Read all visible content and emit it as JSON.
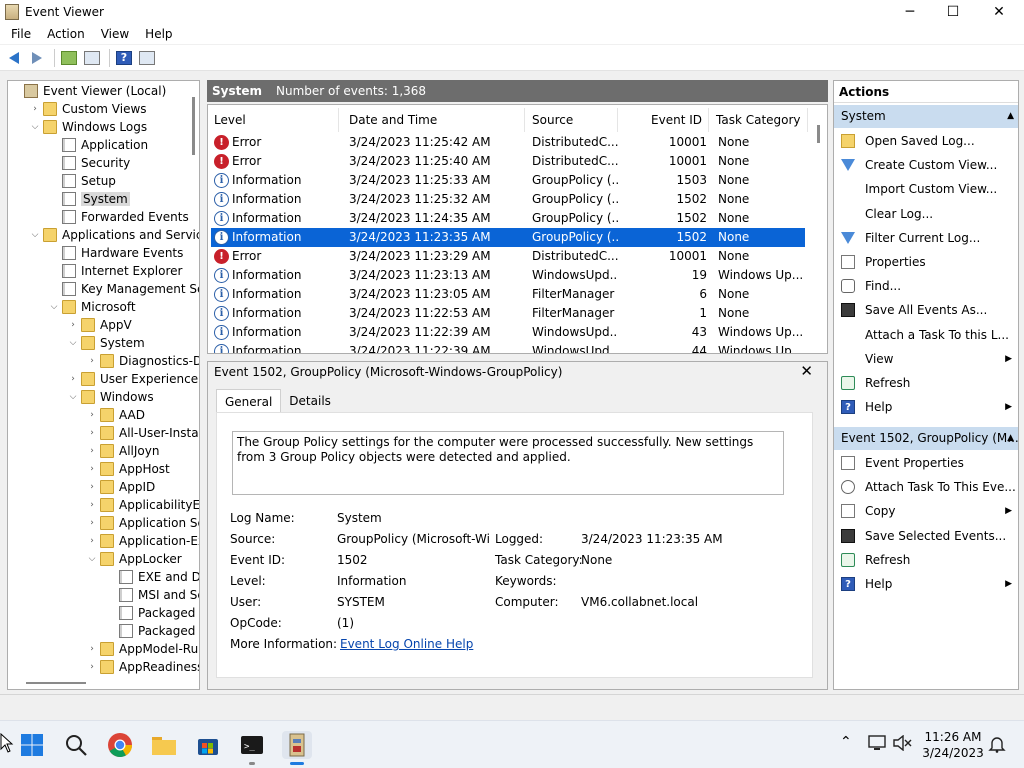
{
  "window": {
    "title": "Event Viewer",
    "minimize": "─",
    "maximize": "☐",
    "close": "✕"
  },
  "menu": [
    "File",
    "Action",
    "View",
    "Help"
  ],
  "tree": [
    {
      "label": "Event Viewer (Local)",
      "indent": 0,
      "chev": "",
      "icon": "root"
    },
    {
      "label": "Custom Views",
      "indent": 1,
      "chev": "›",
      "icon": "folder"
    },
    {
      "label": "Windows Logs",
      "indent": 1,
      "chev": "⌄",
      "icon": "folder"
    },
    {
      "label": "Application",
      "indent": 2,
      "chev": "",
      "icon": "log"
    },
    {
      "label": "Security",
      "indent": 2,
      "chev": "",
      "icon": "log"
    },
    {
      "label": "Setup",
      "indent": 2,
      "chev": "",
      "icon": "log"
    },
    {
      "label": "System",
      "indent": 2,
      "chev": "",
      "icon": "log",
      "selected": true
    },
    {
      "label": "Forwarded Events",
      "indent": 2,
      "chev": "",
      "icon": "log"
    },
    {
      "label": "Applications and Services",
      "indent": 1,
      "chev": "⌄",
      "icon": "folder"
    },
    {
      "label": "Hardware Events",
      "indent": 2,
      "chev": "",
      "icon": "log"
    },
    {
      "label": "Internet Explorer",
      "indent": 2,
      "chev": "",
      "icon": "log"
    },
    {
      "label": "Key Management Ser",
      "indent": 2,
      "chev": "",
      "icon": "log"
    },
    {
      "label": "Microsoft",
      "indent": 2,
      "chev": "⌄",
      "icon": "folder"
    },
    {
      "label": "AppV",
      "indent": 3,
      "chev": "›",
      "icon": "folder"
    },
    {
      "label": "System",
      "indent": 3,
      "chev": "⌄",
      "icon": "folder"
    },
    {
      "label": "Diagnostics-Di",
      "indent": 4,
      "chev": "›",
      "icon": "folder"
    },
    {
      "label": "User Experience Vi",
      "indent": 3,
      "chev": "›",
      "icon": "folder"
    },
    {
      "label": "Windows",
      "indent": 3,
      "chev": "⌄",
      "icon": "folder"
    },
    {
      "label": "AAD",
      "indent": 4,
      "chev": "›",
      "icon": "folder"
    },
    {
      "label": "All-User-Instal",
      "indent": 4,
      "chev": "›",
      "icon": "folder"
    },
    {
      "label": "AllJoyn",
      "indent": 4,
      "chev": "›",
      "icon": "folder"
    },
    {
      "label": "AppHost",
      "indent": 4,
      "chev": "›",
      "icon": "folder"
    },
    {
      "label": "AppID",
      "indent": 4,
      "chev": "›",
      "icon": "folder"
    },
    {
      "label": "ApplicabilityEr",
      "indent": 4,
      "chev": "›",
      "icon": "folder"
    },
    {
      "label": "Application Se",
      "indent": 4,
      "chev": "›",
      "icon": "folder"
    },
    {
      "label": "Application-Ex",
      "indent": 4,
      "chev": "›",
      "icon": "folder"
    },
    {
      "label": "AppLocker",
      "indent": 4,
      "chev": "⌄",
      "icon": "folder"
    },
    {
      "label": "EXE and DL",
      "indent": 5,
      "chev": "",
      "icon": "log"
    },
    {
      "label": "MSI and Sc",
      "indent": 5,
      "chev": "",
      "icon": "log"
    },
    {
      "label": "Packaged a",
      "indent": 5,
      "chev": "",
      "icon": "log"
    },
    {
      "label": "Packaged a",
      "indent": 5,
      "chev": "",
      "icon": "log"
    },
    {
      "label": "AppModel-Ru",
      "indent": 4,
      "chev": "›",
      "icon": "folder"
    },
    {
      "label": "AppReadiness",
      "indent": 4,
      "chev": "›",
      "icon": "folder"
    }
  ],
  "log_header": {
    "name": "System",
    "count": "Number of events: 1,368"
  },
  "columns": [
    "Level",
    "Date and Time",
    "Source",
    "Event ID",
    "Task Category"
  ],
  "events": [
    {
      "level": "Error",
      "kind": "err",
      "date": "3/24/2023 11:25:42 AM",
      "source": "DistributedC...",
      "id": "10001",
      "task": "None"
    },
    {
      "level": "Error",
      "kind": "err",
      "date": "3/24/2023 11:25:40 AM",
      "source": "DistributedC...",
      "id": "10001",
      "task": "None"
    },
    {
      "level": "Information",
      "kind": "inf",
      "date": "3/24/2023 11:25:33 AM",
      "source": "GroupPolicy (...",
      "id": "1503",
      "task": "None"
    },
    {
      "level": "Information",
      "kind": "inf",
      "date": "3/24/2023 11:25:32 AM",
      "source": "GroupPolicy (...",
      "id": "1502",
      "task": "None"
    },
    {
      "level": "Information",
      "kind": "inf",
      "date": "3/24/2023 11:24:35 AM",
      "source": "GroupPolicy (...",
      "id": "1502",
      "task": "None"
    },
    {
      "level": "Information",
      "kind": "inf",
      "date": "3/24/2023 11:23:35 AM",
      "source": "GroupPolicy (...",
      "id": "1502",
      "task": "None",
      "selected": true
    },
    {
      "level": "Error",
      "kind": "err",
      "date": "3/24/2023 11:23:29 AM",
      "source": "DistributedC...",
      "id": "10001",
      "task": "None"
    },
    {
      "level": "Information",
      "kind": "inf",
      "date": "3/24/2023 11:23:13 AM",
      "source": "WindowsUpd...",
      "id": "19",
      "task": "Windows Up..."
    },
    {
      "level": "Information",
      "kind": "inf",
      "date": "3/24/2023 11:23:05 AM",
      "source": "FilterManager",
      "id": "6",
      "task": "None"
    },
    {
      "level": "Information",
      "kind": "inf",
      "date": "3/24/2023 11:22:53 AM",
      "source": "FilterManager",
      "id": "1",
      "task": "None"
    },
    {
      "level": "Information",
      "kind": "inf",
      "date": "3/24/2023 11:22:39 AM",
      "source": "WindowsUpd...",
      "id": "43",
      "task": "Windows Up..."
    },
    {
      "level": "Information",
      "kind": "inf",
      "date": "3/24/2023 11:22:39 AM",
      "source": "WindowsUpd...",
      "id": "44",
      "task": "Windows Up..."
    }
  ],
  "detail": {
    "title": "Event 1502, GroupPolicy (Microsoft-Windows-GroupPolicy)",
    "close": "✕",
    "tab_general": "General",
    "tab_details": "Details",
    "description": "The Group Policy settings for the computer were processed successfully. New settings from 3 Group Policy objects were detected and applied.",
    "log_name_label": "Log Name:",
    "log_name": "System",
    "source_label": "Source:",
    "source": "GroupPolicy (Microsoft-Win",
    "logged_label": "Logged:",
    "logged": "3/24/2023 11:23:35 AM",
    "event_id_label": "Event ID:",
    "event_id": "1502",
    "task_label": "Task Category:",
    "task": "None",
    "level_label": "Level:",
    "level": "Information",
    "keywords_label": "Keywords:",
    "keywords": "",
    "user_label": "User:",
    "user": "SYSTEM",
    "computer_label": "Computer:",
    "computer": "VM6.collabnet.local",
    "opcode_label": "OpCode:",
    "opcode": "(1)",
    "more_label": "More Information:",
    "more_link": "Event Log Online Help"
  },
  "actions": {
    "title": "Actions",
    "section1": "System",
    "items1": [
      {
        "label": "Open Saved Log...",
        "icon": "open"
      },
      {
        "label": "Create Custom View...",
        "icon": "filter"
      },
      {
        "label": "Import Custom View...",
        "icon": "blank"
      },
      {
        "label": "Clear Log...",
        "icon": "blank"
      },
      {
        "label": "Filter Current Log...",
        "icon": "filter"
      },
      {
        "label": "Properties",
        "icon": "doc"
      },
      {
        "label": "Find...",
        "icon": "find"
      },
      {
        "label": "Save All Events As...",
        "icon": "save"
      },
      {
        "label": "Attach a Task To this L...",
        "icon": "blank"
      },
      {
        "label": "View",
        "icon": "blank",
        "sub": true
      },
      {
        "label": "Refresh",
        "icon": "refresh"
      },
      {
        "label": "Help",
        "icon": "help",
        "sub": true
      }
    ],
    "section2": "Event 1502, GroupPolicy (M...",
    "items2": [
      {
        "label": "Event Properties",
        "icon": "doc"
      },
      {
        "label": "Attach Task To This Eve...",
        "icon": "clock"
      },
      {
        "label": "Copy",
        "icon": "doc",
        "sub": true
      },
      {
        "label": "Save Selected Events...",
        "icon": "save"
      },
      {
        "label": "Refresh",
        "icon": "refresh"
      },
      {
        "label": "Help",
        "icon": "help",
        "sub": true
      }
    ]
  },
  "clock": {
    "time": "11:26 AM",
    "date": "3/24/2023"
  }
}
